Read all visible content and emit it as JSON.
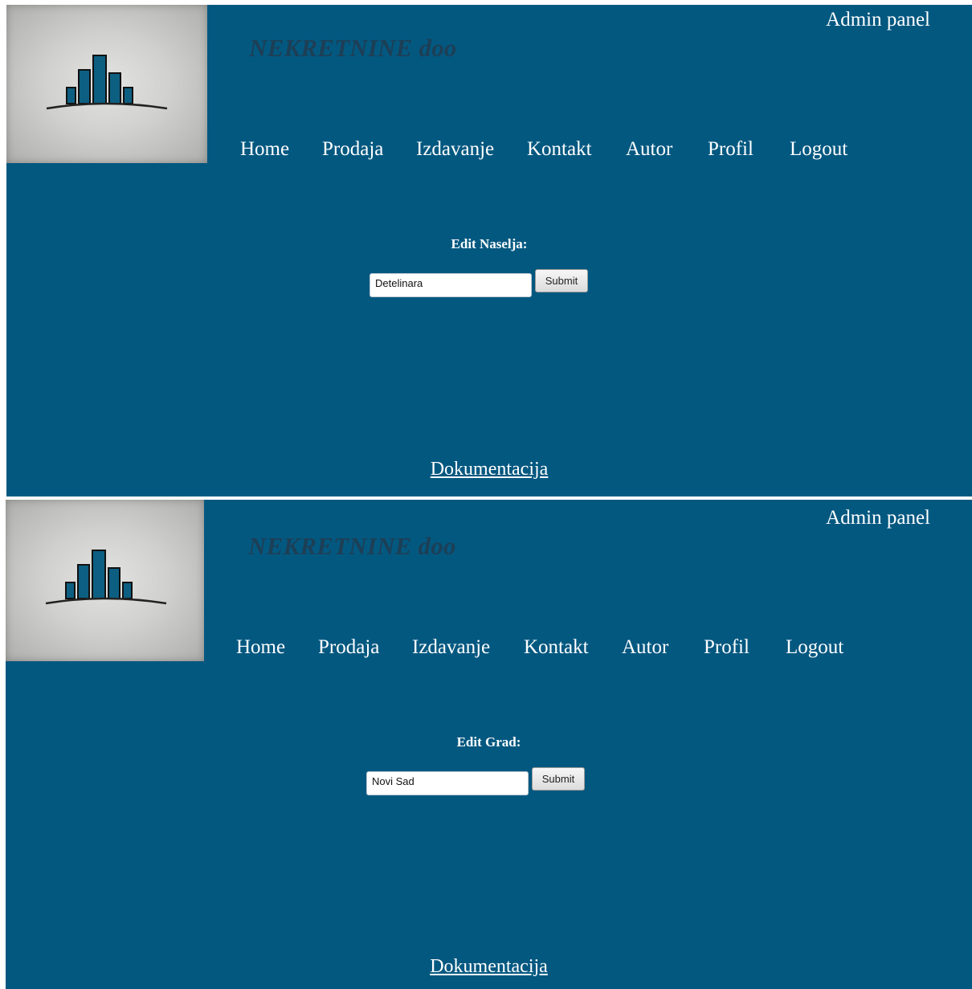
{
  "header": {
    "brand": "NEKRETNINE doo",
    "admin_link": "Admin panel"
  },
  "nav": [
    "Home",
    "Prodaja",
    "Izdavanje",
    "Kontakt",
    "Autor",
    "Profil",
    "Logout"
  ],
  "screens": [
    {
      "form_title": "Edit Naselja:",
      "input_value": "Detelinara",
      "submit_label": "Submit"
    },
    {
      "form_title": "Edit Grad:",
      "input_value": "Novi Sad",
      "submit_label": "Submit"
    }
  ],
  "footer": {
    "doc_link": "Dokumentacija"
  },
  "colors": {
    "background": "#035880",
    "brand_text": "#1d3f56",
    "logo_tile": "#c8c8c6"
  }
}
